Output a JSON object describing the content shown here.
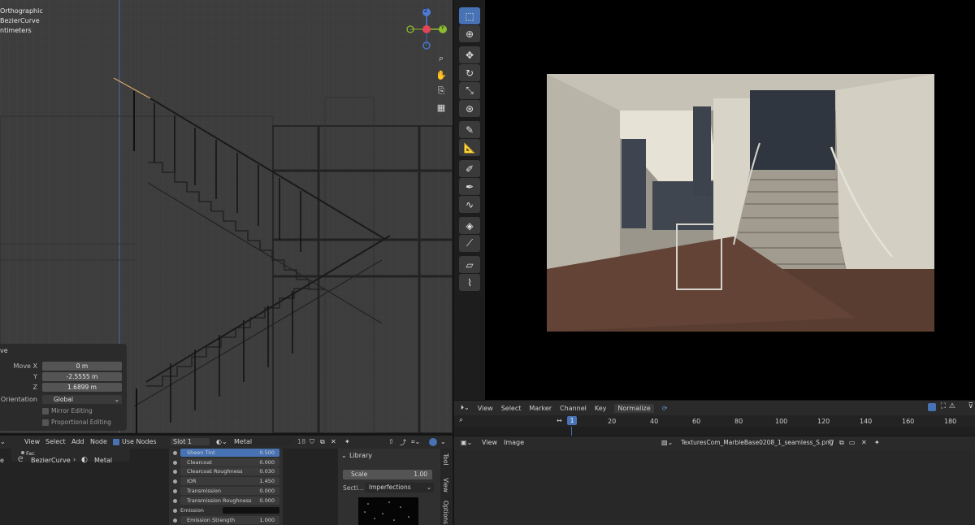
{
  "viewport": {
    "overlay_lines": [
      "Orthographic",
      "BezierCurve",
      "ntimeters"
    ],
    "gizmo_axes": [
      "Z",
      "Y"
    ],
    "nav_icons": [
      "zoom-icon",
      "hand-icon",
      "camera-icon",
      "grid-icon"
    ]
  },
  "operator_panel": {
    "title": "ve",
    "move_x_label": "Move X",
    "move_x_value": "0 m",
    "y_label": "Y",
    "y_value": "-2.5555 m",
    "z_label": "Z",
    "z_value": "1.6899 m",
    "orientation_label": "Orientation",
    "orientation_value": "Global",
    "mirror_editing": "Mirror Editing",
    "proportional_editing": "Proportional Editing"
  },
  "timeline": {
    "menus": [
      "View",
      "Marker",
      "Channel",
      "Key"
    ],
    "select_label": "Select",
    "normalize_label": "Normalize",
    "current_frame": "1",
    "ticks": [
      "20",
      "40",
      "60",
      "80",
      "100",
      "120",
      "140",
      "160",
      "180"
    ]
  },
  "image_editor": {
    "menus": [
      "View",
      "Image"
    ],
    "image_name": "TexturesCom_MarbleBase0208_1_seamless_S.png"
  },
  "node_editor": {
    "menus": [
      "View",
      "Select",
      "Add",
      "Node"
    ],
    "use_nodes_label": "Use Nodes",
    "slot": "Slot 1",
    "material": "Metal",
    "user_count": "18",
    "breadcrumb_object": "BezierCurve",
    "breadcrumb_material": "Metal",
    "fac_label": "Fac",
    "properties": [
      {
        "label": "Sheen Tint",
        "value": "0.500"
      },
      {
        "label": "Clearcoat",
        "value": "0.000"
      },
      {
        "label": "Clearcoat Roughness",
        "value": "0.030"
      },
      {
        "label": "IOR",
        "value": "1.450"
      },
      {
        "label": "Transmission",
        "value": "0.000"
      },
      {
        "label": "Transmission Roughness",
        "value": "0.000"
      },
      {
        "label": "Emission",
        "value": ""
      },
      {
        "label": "Emission Strength",
        "value": "1.000"
      }
    ],
    "library_title": "Library",
    "scale_label": "Scale",
    "scale_value": "1.00",
    "section_label": "Secti...",
    "section_value": "Imperfections",
    "side_tabs": [
      "Tool",
      "View",
      "Options"
    ]
  },
  "colors": {
    "accent": "#4772b3",
    "x_axis": "#e2445a",
    "y_axis": "#8bbb2e",
    "z_axis": "#4d7bd6"
  }
}
